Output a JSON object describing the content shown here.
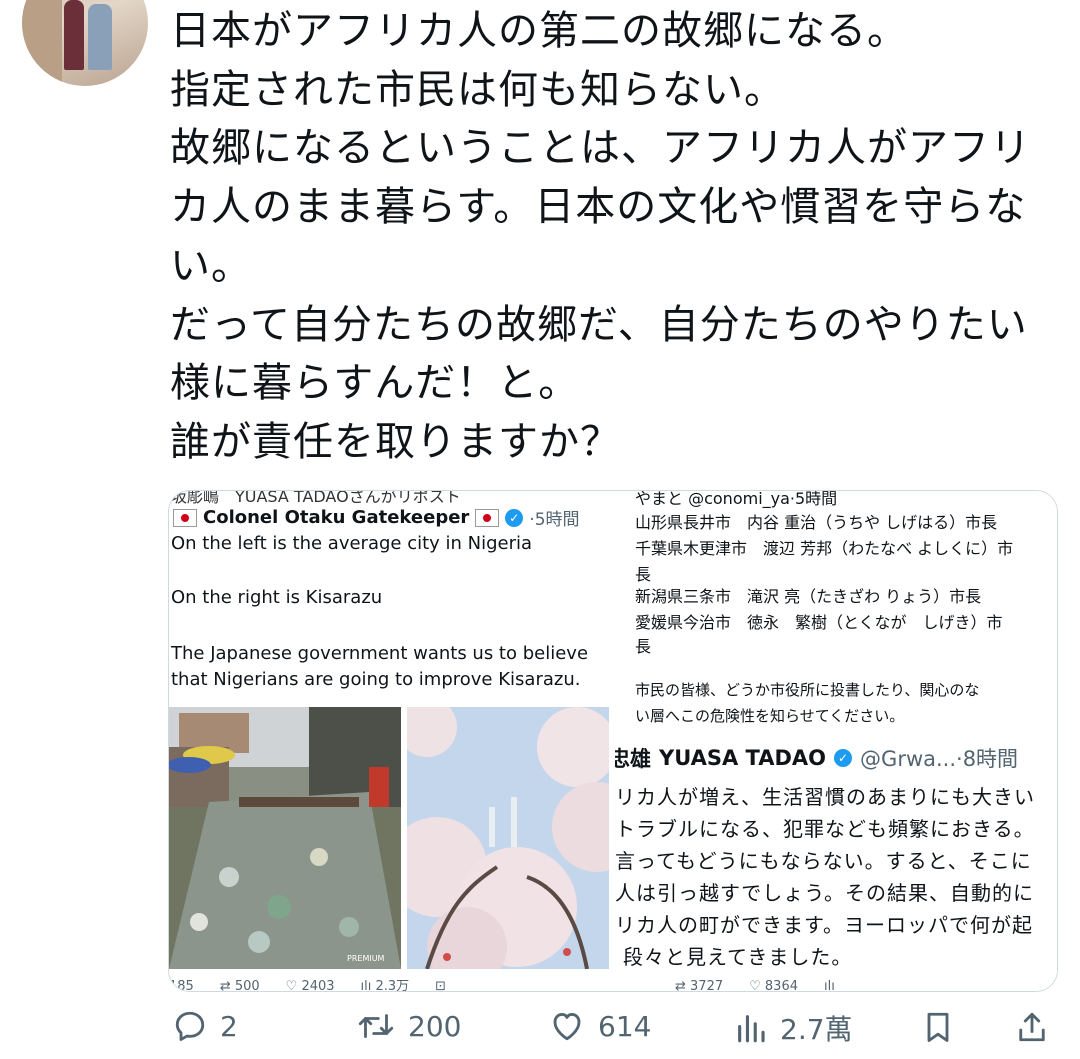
{
  "tweet": {
    "lines": [
      "日本がアフリカ人の第二の故郷になる。",
      "指定された市民は何も知らない。",
      "故郷になるということは、アフリカ人がアフリ",
      "カ人のまま暮らす。日本の文化や慣習を守らな",
      "い。",
      "だって自分たちの故郷だ、自分たちのやりたい",
      "様に暮らすんだ！と。",
      "誰が責任を取りますか？"
    ]
  },
  "media": {
    "left_post": {
      "cut_text": "坂彫嶋　YUASA TADAOさんがリポスト",
      "name": "Colonel Otaku Gatekeeper",
      "time": "·5時間",
      "lines": [
        "On the left is the average city in Nigeria",
        "On the right is Kisarazu",
        "The Japanese government wants us to believe",
        "that Nigerians are going to improve Kisarazu."
      ],
      "photo_watermark": "PREMIUM",
      "stats_cut": "185　　⇄ 500　　♡ 2403　　ılı 2.3万　　⊡"
    },
    "right_post": {
      "cut_header": "やまと @conomi_ya·5時間",
      "lines": [
        "山形県長井市　内谷 重治（うちや しげはる）市長",
        "千葉県木更津市　渡辺 芳邦（わたなべ よしくに）市",
        "長",
        "新潟県三条市　滝沢 亮（たきざわ りょう）市長",
        "愛媛県今治市　徳永　繁樹（とくなが　しげき）市",
        "長",
        "市民の皆様、どうか市役所に投書したり、関心のな",
        "い層へこの危険性を知らせてください。"
      ],
      "second_author_cut": "忠雄",
      "second_author": "YUASA TADAO",
      "second_handle": "@Grwa...·8時間",
      "second_lines": [
        "リカ人が増え、生活習慣のあまりにも大きい",
        "トラブルになる、犯罪なども頻繁におきる。",
        "言ってもどうにもならない。すると、そこに",
        "人は引っ越すでしょう。その結果、自動的に",
        "リカ人の町ができます。ヨーロッパで何が起",
        "段々と見えてきました。"
      ],
      "stats_cut": "⇄ 3727　　♡ 8364　　ılı"
    }
  },
  "actions": {
    "reply_count": "2",
    "retweet_count": "200",
    "like_count": "614",
    "views_count": "2.7萬"
  },
  "colors": {
    "text": "#0f1419",
    "secondary": "#536471",
    "border": "#cfd9de",
    "verified": "#1d9bf0"
  }
}
